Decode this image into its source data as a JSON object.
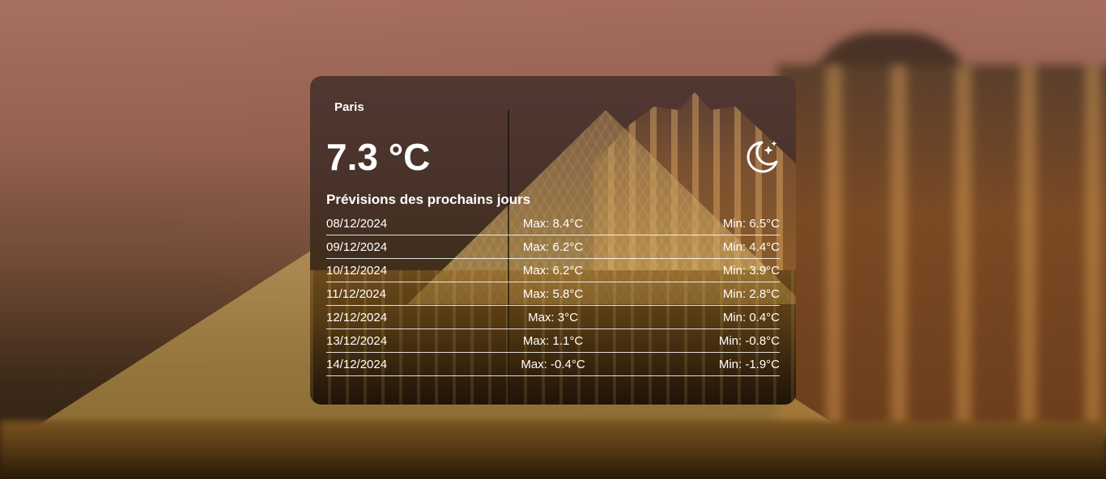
{
  "city": "Paris",
  "current": {
    "temperature": "7.3 °C",
    "icon": "moon-stars-icon"
  },
  "forecast_title": "Prévisions des prochains jours",
  "forecast": [
    {
      "date": "08/12/2024",
      "max": "Max: 8.4°C",
      "min": "Min: 6.5°C"
    },
    {
      "date": "09/12/2024",
      "max": "Max: 6.2°C",
      "min": "Min: 4.4°C"
    },
    {
      "date": "10/12/2024",
      "max": "Max: 6.2°C",
      "min": "Min: 3.9°C"
    },
    {
      "date": "11/12/2024",
      "max": "Max: 5.8°C",
      "min": "Min: 2.8°C"
    },
    {
      "date": "12/12/2024",
      "max": "Max: 3°C",
      "min": "Min: 0.4°C"
    },
    {
      "date": "13/12/2024",
      "max": "Max: 1.1°C",
      "min": "Min: -0.8°C"
    },
    {
      "date": "14/12/2024",
      "max": "Max: -0.4°C",
      "min": "Min: -1.9°C"
    }
  ],
  "colors": {
    "text": "#ffffff"
  }
}
